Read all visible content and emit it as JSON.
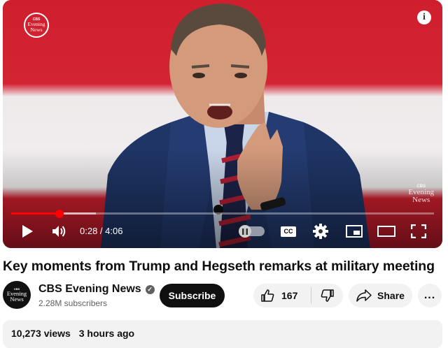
{
  "player": {
    "channel_bug": [
      "CBS",
      "Evening",
      "News"
    ],
    "watermark": [
      "CBS",
      "Evening",
      "News"
    ],
    "current_time": "0:28",
    "duration": "4:06",
    "time_display": "0:28 / 4:06",
    "progress_played": 0.114,
    "progress_loaded": 0.2,
    "cc_label": "CC",
    "info_label": "i",
    "colors": {
      "progress": "#ff0000"
    }
  },
  "video": {
    "title": "Key moments from Trump and Hegseth remarks at military meeting",
    "channel": {
      "name": "CBS Evening News",
      "subscribers": "2.28M subscribers",
      "verified": true,
      "avatar_lines": [
        "CBS",
        "Evening",
        "News"
      ]
    },
    "actions": {
      "subscribe_label": "Subscribe",
      "like_count": "167",
      "share_label": "Share",
      "more_label": "..."
    },
    "description": {
      "views": "10,273 views",
      "age": "3 hours ago"
    }
  }
}
